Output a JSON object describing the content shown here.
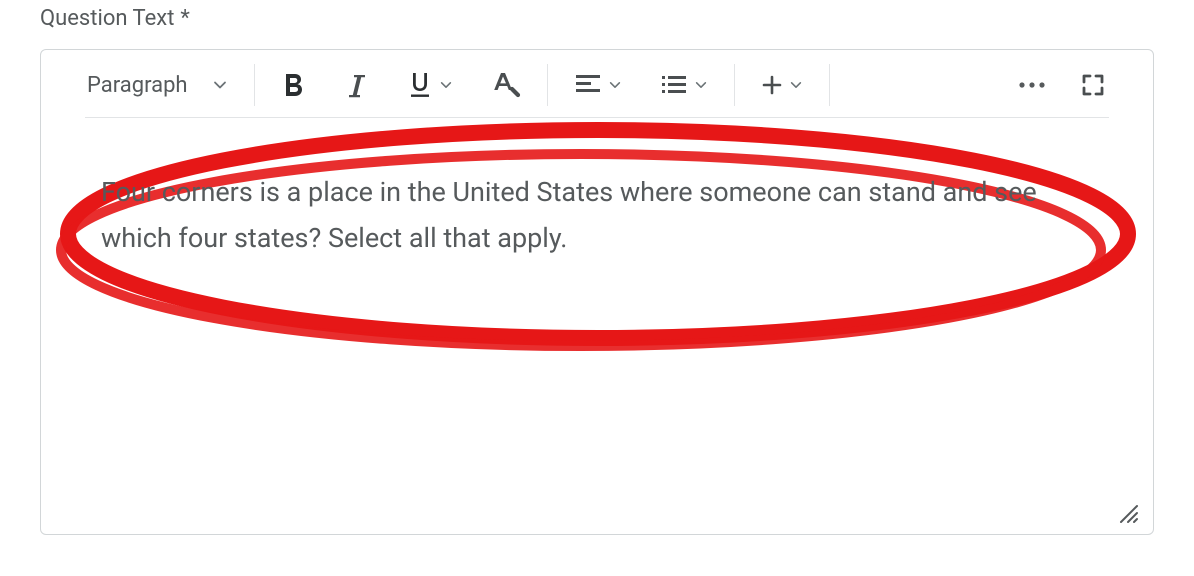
{
  "label": "Question Text",
  "required_marker": "*",
  "toolbar": {
    "block_format": "Paragraph"
  },
  "content": "Four corners is a place in the United States where someone can stand and see which four states? Select all that apply."
}
